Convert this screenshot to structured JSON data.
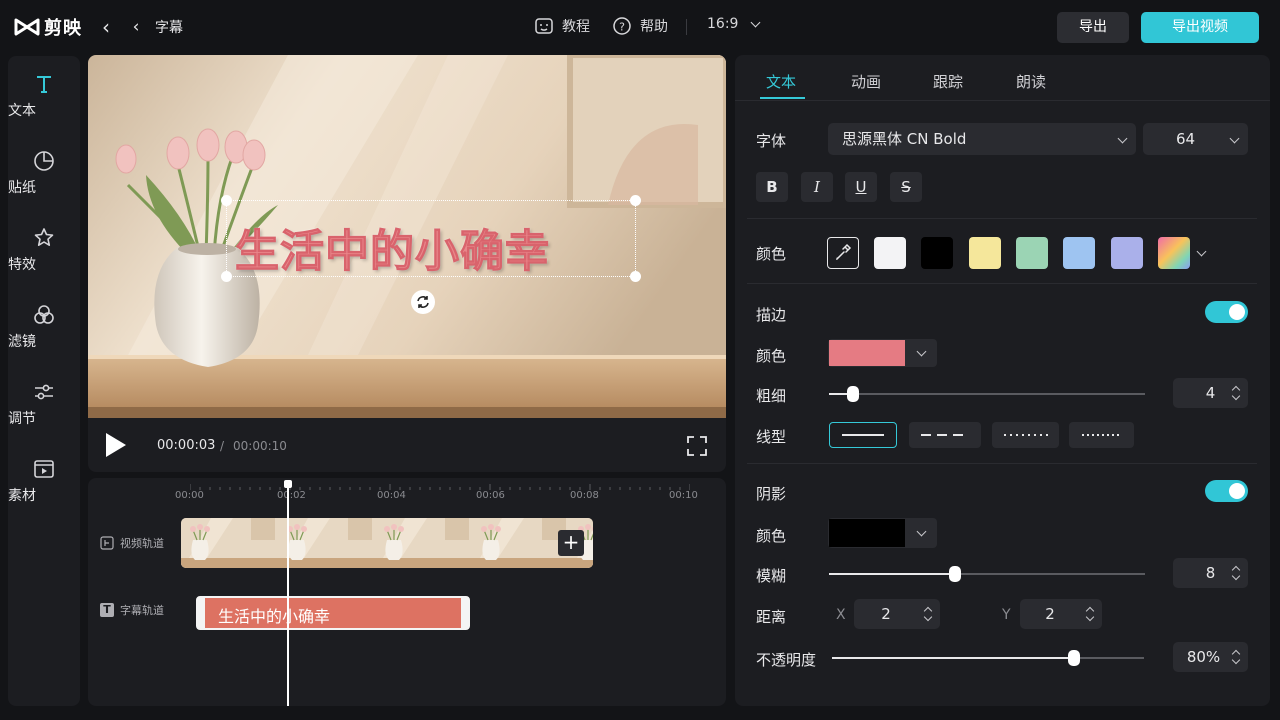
{
  "app": {
    "name": "剪映",
    "breadcrumb": "字幕"
  },
  "header": {
    "tutorial": "教程",
    "help": "帮助",
    "ratio": "16:9",
    "export": "导出",
    "export_video": "导出视频"
  },
  "rail": [
    {
      "label": "文本",
      "icon": "text-icon",
      "active": true
    },
    {
      "label": "贴纸",
      "icon": "sticker-icon",
      "active": false
    },
    {
      "label": "特效",
      "icon": "effects-icon",
      "active": false
    },
    {
      "label": "滤镜",
      "icon": "filter-icon",
      "active": false
    },
    {
      "label": "调节",
      "icon": "adjust-icon",
      "active": false
    },
    {
      "label": "素材",
      "icon": "media-icon",
      "active": false
    }
  ],
  "preview": {
    "caption": "生活中的小确幸"
  },
  "player": {
    "current": "00:00:03",
    "separator": "/",
    "total": "00:00:10"
  },
  "timeline": {
    "ticks": [
      "00:00",
      "00:02",
      "00:04",
      "00:06",
      "00:08",
      "00:10"
    ],
    "video_track": "视频轨道",
    "subtitle_track": "字幕轨道",
    "subtitle_clip": "生活中的小确幸",
    "add": "+"
  },
  "panel": {
    "tabs": [
      "文本",
      "动画",
      "跟踪",
      "朗读"
    ],
    "font_label": "字体",
    "font_value": "思源黑体 CN Bold",
    "font_size": "64",
    "format": {
      "bold": "B",
      "italic": "I",
      "underline": "U",
      "strike": "S"
    },
    "color_label": "颜色",
    "swatches": [
      "#f3f3f5",
      "#000000",
      "#f5e79b",
      "#9bd4b4",
      "#9ec4f1",
      "#aab0ea"
    ],
    "stroke": {
      "label": "描边",
      "color_label": "颜色",
      "color": "#e57b83",
      "width_label": "粗细",
      "width_value": "4",
      "width_level": 0.05,
      "style_label": "线型"
    },
    "shadow": {
      "label": "阴影",
      "color_label": "颜色",
      "color": "#000000",
      "blur_label": "模糊",
      "blur_value": "8",
      "blur_level": 0.4,
      "distance_label": "距离",
      "x_label": "X",
      "x_value": "2",
      "y_label": "Y",
      "y_value": "2",
      "opacity_label": "不透明度",
      "opacity_value": "80%",
      "opacity_level": 0.8
    }
  },
  "colors": {
    "accent": "#31c6d6",
    "caption_fill": "#e9878b"
  }
}
